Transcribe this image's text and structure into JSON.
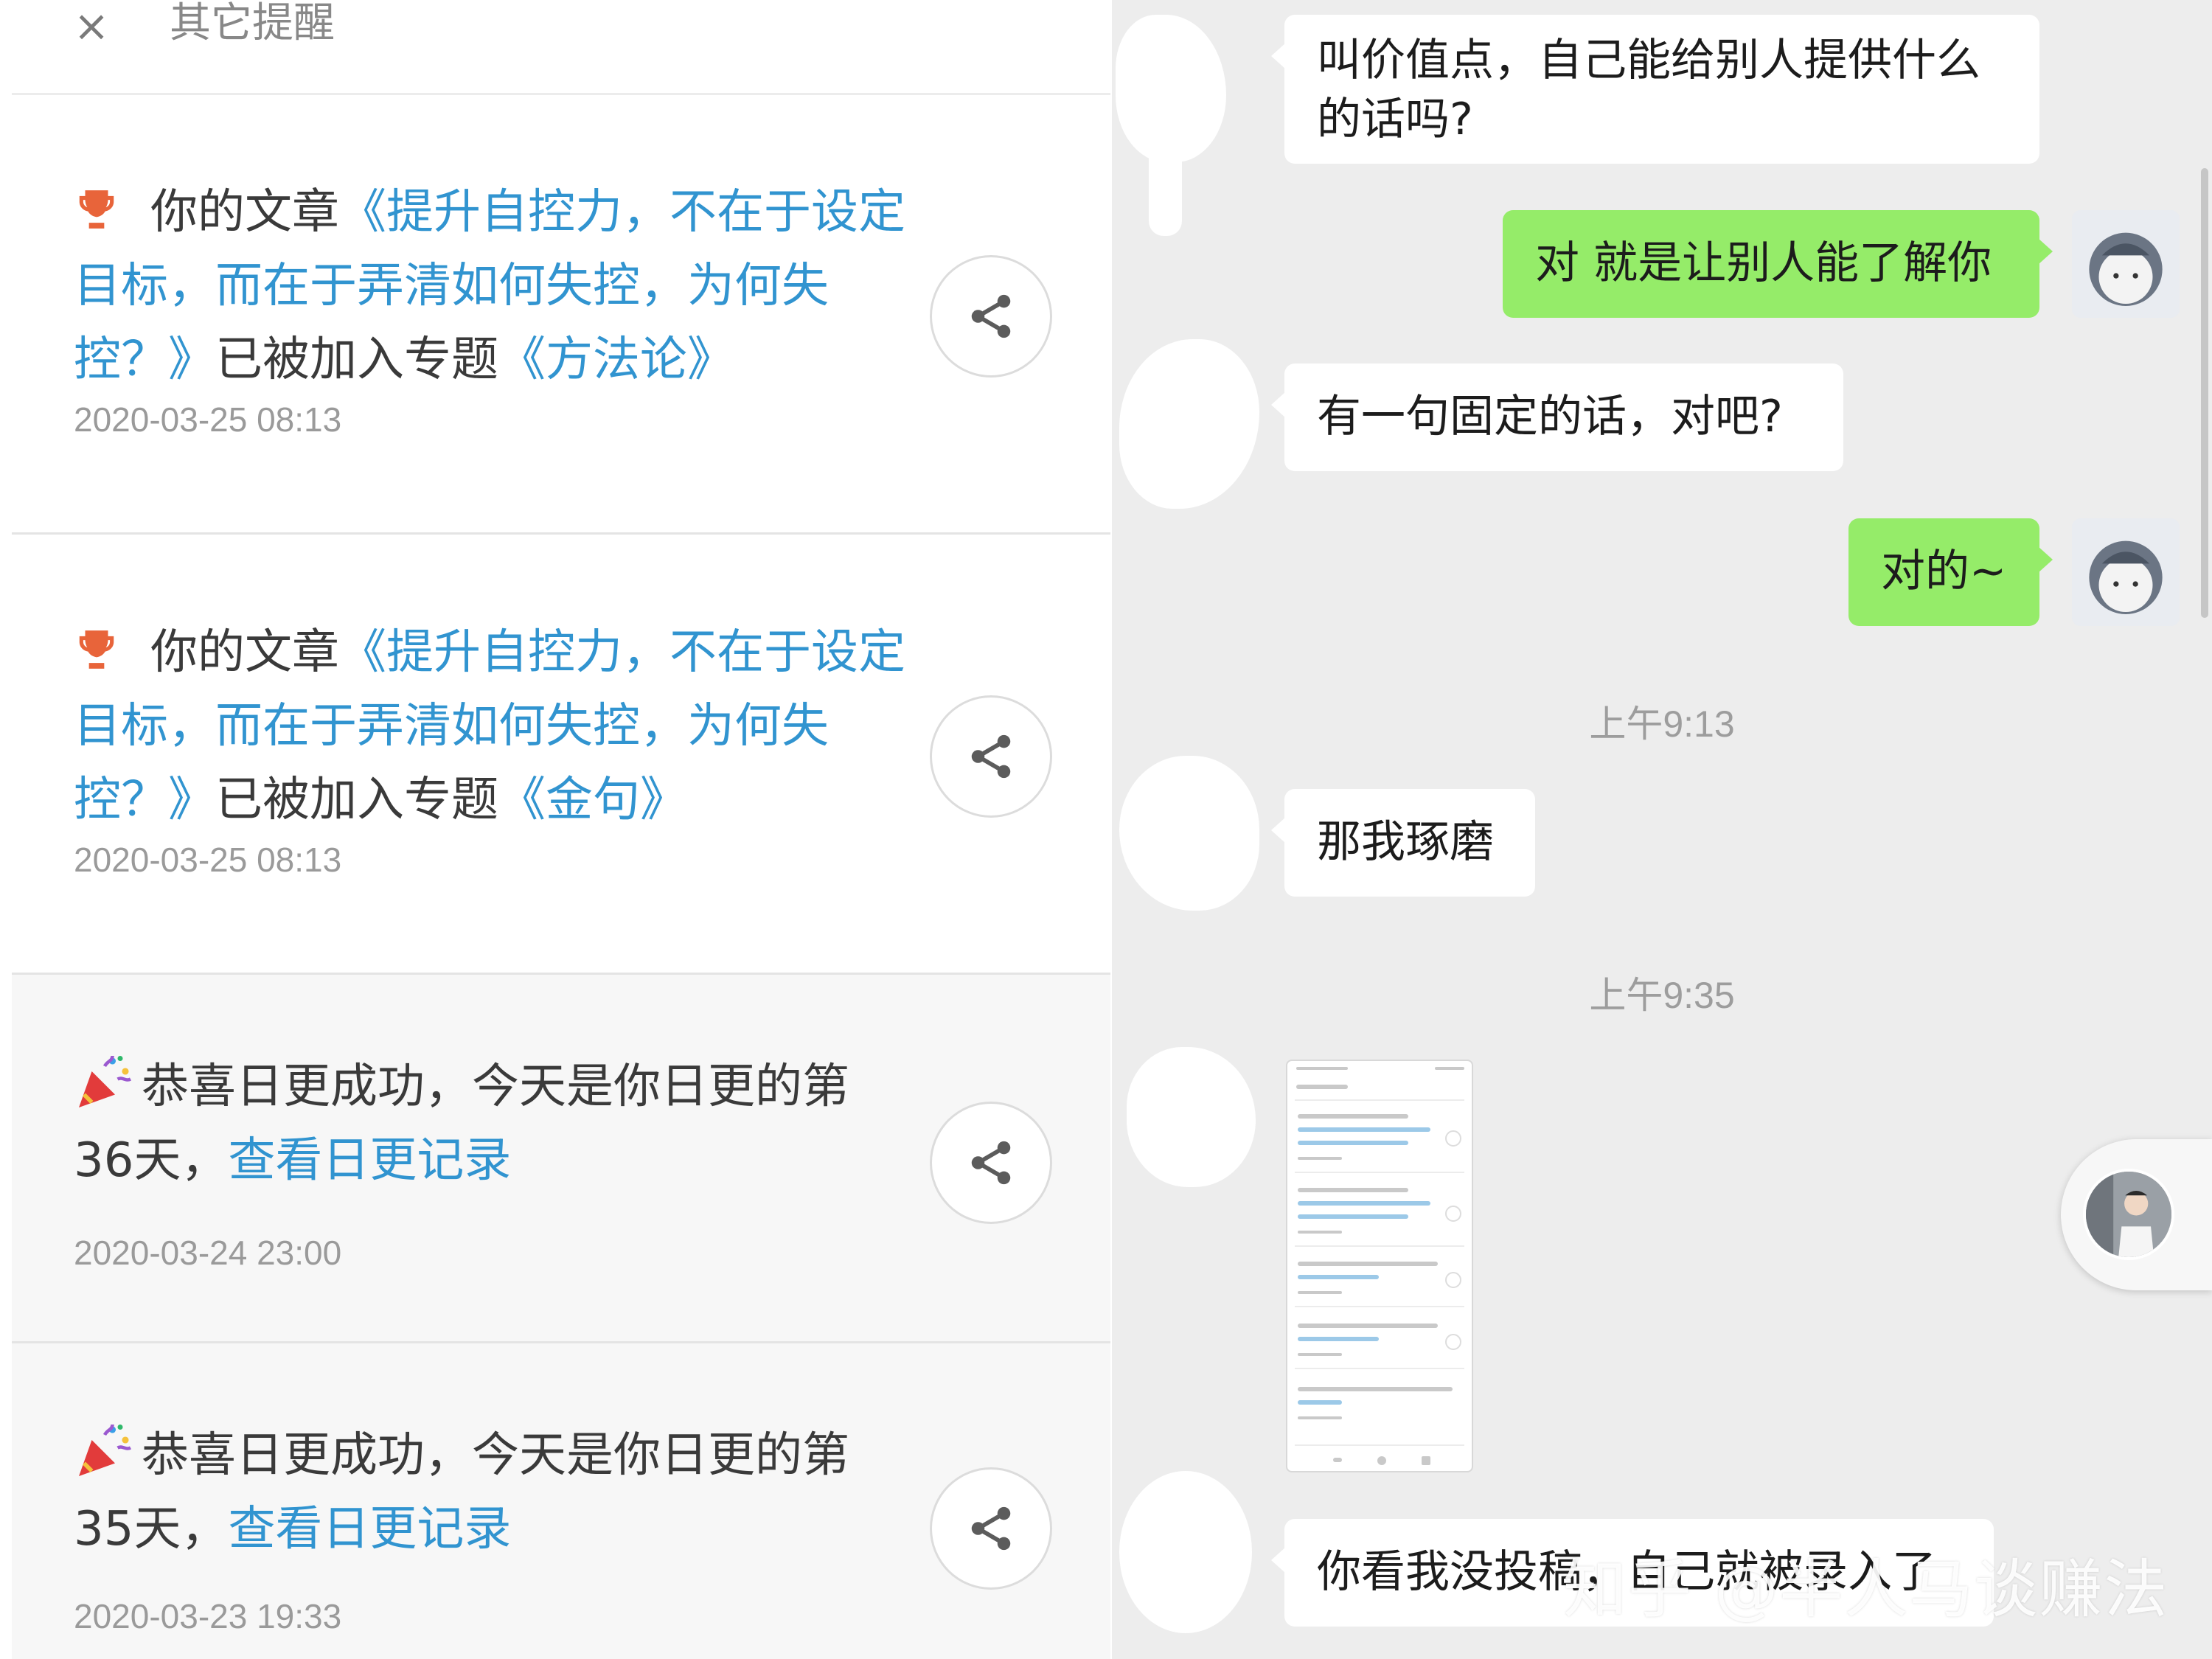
{
  "notifications_panel": {
    "header_title": "其它提醒",
    "close_glyph": "×",
    "items": [
      {
        "icon": "trophy-icon",
        "prefix": "你的文章",
        "article_link": "《提升自控力，不在于设定目标，而在于弄清如何失控，为何失控？》",
        "middle": "已被加入专题",
        "topic_link": "《方法论》",
        "time": "2020-03-25 08:13"
      },
      {
        "icon": "trophy-icon",
        "prefix": "你的文章",
        "article_link": "《提升自控力，不在于设定目标，而在于弄清如何失控，为何失控？》",
        "middle": "已被加入专题",
        "topic_link": "《金句》",
        "time": "2020-03-25 08:13"
      },
      {
        "icon": "party-popper-icon",
        "text": "恭喜日更成功，今天是你日更的第36天，",
        "link": "查看日更记录",
        "time": "2020-03-24 23:00"
      },
      {
        "icon": "party-popper-icon",
        "text": "恭喜日更成功，今天是你日更的第35天，",
        "link": "查看日更记录",
        "time": "2020-03-23 19:33"
      }
    ]
  },
  "chat_panel": {
    "messages": [
      {
        "from": "them",
        "text_line1": "叫价值点，自己能给别人提供什么",
        "text_line2": "的话吗?"
      },
      {
        "from": "me",
        "text": "对 就是让别人能了解你"
      },
      {
        "from": "them",
        "text": "有一句固定的话，对吧?"
      },
      {
        "from": "me",
        "text": "对的~"
      },
      {
        "from": "them",
        "text": "那我琢磨"
      },
      {
        "from": "them",
        "text": "你看我没投稿，自己就被录入了"
      }
    ],
    "timestamps": [
      "上午9:13",
      "上午9:35"
    ],
    "shared_image": "screenshot-thumbnail"
  },
  "watermark": "知乎 @半人马谈赚法",
  "colors": {
    "link": "#3194d0",
    "my_bubble": "#95ec69",
    "chat_background": "#ededed",
    "trophy": "#e8643a"
  }
}
